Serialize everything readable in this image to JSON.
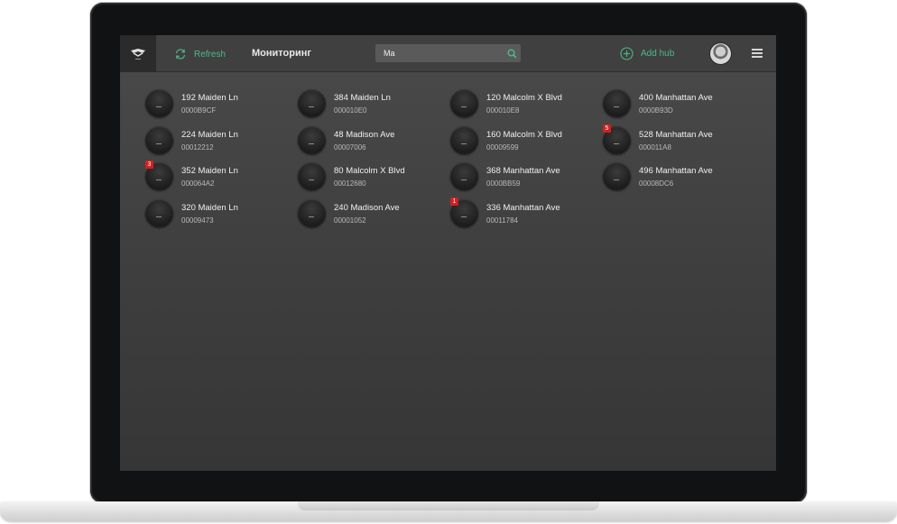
{
  "topbar": {
    "refresh_label": "Refresh",
    "title": "Мониторинг",
    "search_value": "Ma",
    "add_hub_label": "Add hub"
  },
  "colors": {
    "accent": "#4fb987",
    "badge": "#d0201f",
    "background": "#404040"
  },
  "icons": [
    "ajax-logo-icon",
    "refresh-icon",
    "search-icon",
    "add-circle-icon",
    "user-avatar",
    "hamburger-menu-icon",
    "hub-device-icon"
  ],
  "hubs": [
    {
      "name": "192 Maiden Ln",
      "id": "0000B9CF",
      "badge": ""
    },
    {
      "name": "384 Maiden Ln",
      "id": "000010E0",
      "badge": ""
    },
    {
      "name": "120 Malcolm X Blvd",
      "id": "000010E8",
      "badge": ""
    },
    {
      "name": "400 Manhattan Ave",
      "id": "0000B93D",
      "badge": ""
    },
    {
      "name": "224 Maiden Ln",
      "id": "00012212",
      "badge": ""
    },
    {
      "name": "48 Madison Ave",
      "id": "00007006",
      "badge": ""
    },
    {
      "name": "160 Malcolm X Blvd",
      "id": "00009599",
      "badge": ""
    },
    {
      "name": "528 Manhattan Ave",
      "id": "000011A8",
      "badge": "5"
    },
    {
      "name": "352 Maiden Ln",
      "id": "000064A2",
      "badge": "3"
    },
    {
      "name": "80 Malcolm X Blvd",
      "id": "00012680",
      "badge": ""
    },
    {
      "name": "368 Manhattan Ave",
      "id": "0000BB59",
      "badge": ""
    },
    {
      "name": "496 Manhattan Ave",
      "id": "00008DC6",
      "badge": ""
    },
    {
      "name": "320 Maiden Ln",
      "id": "00009473",
      "badge": ""
    },
    {
      "name": "240 Madison Ave",
      "id": "00001052",
      "badge": ""
    },
    {
      "name": "336 Manhattan Ave",
      "id": "00011784",
      "badge": "1"
    }
  ]
}
